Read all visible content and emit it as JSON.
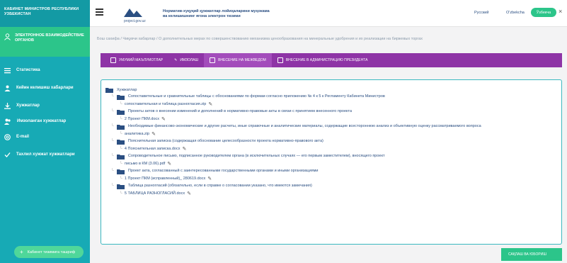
{
  "sidebar": {
    "header": "КАБИНЕТ МИНИСТРОВ РЕСПУБЛИКИ УЗБЕКИСТАН",
    "active": "ЭЛЕКТРОННОЕ ВЗАИМОДЕЙСТВИЕ ОРГАНОВ",
    "items": [
      {
        "label": "Статистика",
        "icon": "list-icon"
      },
      {
        "label": "Кейин келишиш хабарлари",
        "icon": "user-icon"
      },
      {
        "label": "Хужжатлар",
        "icon": "download-icon"
      },
      {
        "label": "Имзоланган хужжатлар",
        "icon": "users-icon"
      },
      {
        "label": "E-mail",
        "icon": "at-icon"
      },
      {
        "label": "Тахлил хужжат хужжатлари",
        "icon": "check-icon"
      }
    ],
    "bottom_button": "Кабинет тизимига ташриф"
  },
  "topbar": {
    "logo_text": "project.gov.uz",
    "title_line1": "Норматив-хуқуқий ҳужжатлар лойиҳаларини муҳокама",
    "title_line2": "ва келишишнинг ягона электрон тизими",
    "lang_ru": "Русский",
    "lang_uz": "O'zbekcha",
    "lang_active": "Ўзбекча"
  },
  "breadcrumb": "Бош сахифа / Чиқувчи хабарлар / О дополнительных мерах по совершенствованию механизма ценообразования на минеральные удобрения и их реализации на биржевых торгах",
  "tabs": [
    {
      "label": "УМУМИЙ МАЪЛУМОТЛАР",
      "active": false
    },
    {
      "label": "ИМЗОЛАШ",
      "active": false
    },
    {
      "label": "ВНЕСЕНИЕ НА МЕЖВЕДОМ",
      "active": true
    },
    {
      "label": "ВНЕСЕНИЕ В АДМИНИСТРАЦИЮ ПРЕЗИДЕНТА",
      "active": false
    }
  ],
  "tree": {
    "root": "Хужжатлар",
    "nodes": [
      {
        "folder": "Сопоставительные и сравнительные таблицы с обоснованиями по формам согласно приложению № 4 к 5 к Регламенту Кабинета Министров",
        "files": [
          "сопоставительная и таблица разногласия.zip"
        ]
      },
      {
        "folder": "Проекты актов о внесении изменений и дополнений в нормативно-правовые акты в связи с принятием внесенного проекта",
        "files": [
          "2 Проект ПКМ.docx"
        ]
      },
      {
        "folder": "Необходимые финансово-экономические и другие расчеты, иные справочные и аналитические материалы, содержащие всестороннюю анализ и объективную оценку рассматриваемого вопроса",
        "files": [
          "аналитика.zip"
        ]
      },
      {
        "folder": "Пояснительная записка (содержащая обоснование целесообразности проекта нормативно-правового акта)",
        "files": [
          "4 Пояснительная записка.docx"
        ]
      },
      {
        "folder": "Сопроводительное письмо, подписанное руководителем органа (в исключительных случаях — его первым заместителем), вносящего проект",
        "files": [
          "письмо в КМ (3.06).pdf"
        ]
      },
      {
        "folder": "Проект акта, согласованный с заинтересованными государственными органами и иными организациями",
        "files": [
          "1 Проект ПКМ (исправленный)_ 280619.docx"
        ]
      },
      {
        "folder": "Таблица разногласий (обязательно, если в справке о согласовании указано, что имеются замечания)",
        "files": [
          "5 ТАБЛИЦА РАЗНОГЛАСИЙ.docx"
        ]
      }
    ]
  },
  "save_button": "САҚЛАШ ВА ЮБОРИШ",
  "colors": {
    "sidebar": "#17aab5",
    "sidebar_active": "#2cc58a",
    "tabs": "#8e34a6",
    "panel_border": "#3bb8c0",
    "link": "#2b4f82"
  }
}
